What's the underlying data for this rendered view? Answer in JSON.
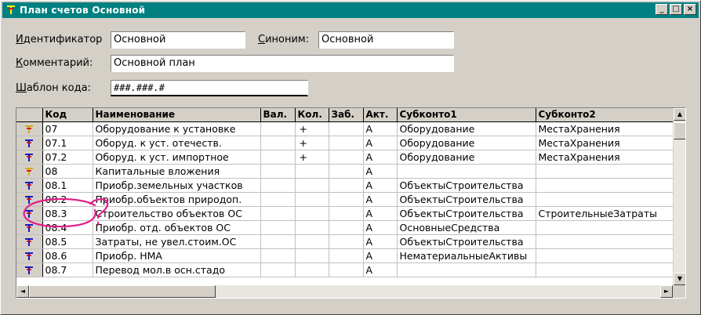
{
  "window": {
    "title": "План счетов Основной",
    "buttons": {
      "minimize": "_",
      "maximize": "□",
      "close": "×"
    }
  },
  "form": {
    "id_label_hotkey": "И",
    "id_label_rest": "дентификатор",
    "id_value": "Основной",
    "synonym_label_hotkey": "С",
    "synonym_label_rest": "иноним:",
    "synonym_value": "Основной",
    "comment_label_hotkey": "К",
    "comment_label_rest": "омментарий:",
    "comment_value": "Основной план",
    "template_label_hotkey": "Ш",
    "template_label_rest": "аблон кода:",
    "template_value": "###.###.#"
  },
  "grid": {
    "columns": [
      "",
      "Код",
      "Наименование",
      "Вал.",
      "Кол.",
      "Заб.",
      "Акт.",
      "Субконто1",
      "Субконто2"
    ],
    "rows": [
      {
        "icon": "account-folder-icon",
        "code": "07",
        "name": "Оборудование к установке",
        "val": "",
        "kol": "+",
        "zab": "",
        "akt": "А",
        "sub1": "Оборудование",
        "sub2": "МестаХранения"
      },
      {
        "icon": "account-icon",
        "code": "07.1",
        "name": "Оборуд. к уст. отечеств.",
        "val": "",
        "kol": "+",
        "zab": "",
        "akt": "А",
        "sub1": "Оборудование",
        "sub2": "МестаХранения"
      },
      {
        "icon": "account-icon",
        "code": "07.2",
        "name": "Оборуд. к уст. импортное",
        "val": "",
        "kol": "+",
        "zab": "",
        "akt": "А",
        "sub1": "Оборудование",
        "sub2": "МестаХранения"
      },
      {
        "icon": "account-folder-icon",
        "code": "08",
        "name": "Капитальные вложения",
        "val": "",
        "kol": "",
        "zab": "",
        "akt": "А",
        "sub1": "",
        "sub2": ""
      },
      {
        "icon": "account-icon",
        "code": "08.1",
        "name": "Приобр.земельных участков",
        "val": "",
        "kol": "",
        "zab": "",
        "akt": "А",
        "sub1": "ОбъектыСтроительства",
        "sub2": ""
      },
      {
        "icon": "account-icon",
        "code": "08.2",
        "name": "Приобр.объектов природоп.",
        "val": "",
        "kol": "",
        "zab": "",
        "akt": "А",
        "sub1": "ОбъектыСтроительства",
        "sub2": ""
      },
      {
        "icon": "account-icon",
        "code": "08.3",
        "name": "Строительство объектов ОС",
        "val": "",
        "kol": "",
        "zab": "",
        "akt": "А",
        "sub1": "ОбъектыСтроительства",
        "sub2": "СтроительныеЗатраты"
      },
      {
        "icon": "account-icon",
        "code": "08.4",
        "name": "Приобр. отд. объектов ОС",
        "val": "",
        "kol": "",
        "zab": "",
        "akt": "А",
        "sub1": "ОсновныеСредства",
        "sub2": ""
      },
      {
        "icon": "account-icon",
        "code": "08.5",
        "name": "Затраты, не увел.стоим.ОС",
        "val": "",
        "kol": "",
        "zab": "",
        "akt": "А",
        "sub1": "ОбъектыСтроительства",
        "sub2": ""
      },
      {
        "icon": "account-icon",
        "code": "08.6",
        "name": "Приобр. НМА",
        "val": "",
        "kol": "",
        "zab": "",
        "akt": "А",
        "sub1": "НематериальныеАктивы",
        "sub2": ""
      },
      {
        "icon": "account-icon",
        "code": "08.7",
        "name": "Перевод мол.в осн.стадо",
        "val": "",
        "kol": "",
        "zab": "",
        "akt": "А",
        "sub1": "",
        "sub2": ""
      }
    ]
  },
  "scroll": {
    "left_arrow": "◄",
    "right_arrow": "►",
    "up_arrow": "▲",
    "down_arrow": "▼"
  },
  "colors": {
    "titlebar": "#008080",
    "face": "#d4d0c8",
    "annotation": "#e0208a"
  }
}
